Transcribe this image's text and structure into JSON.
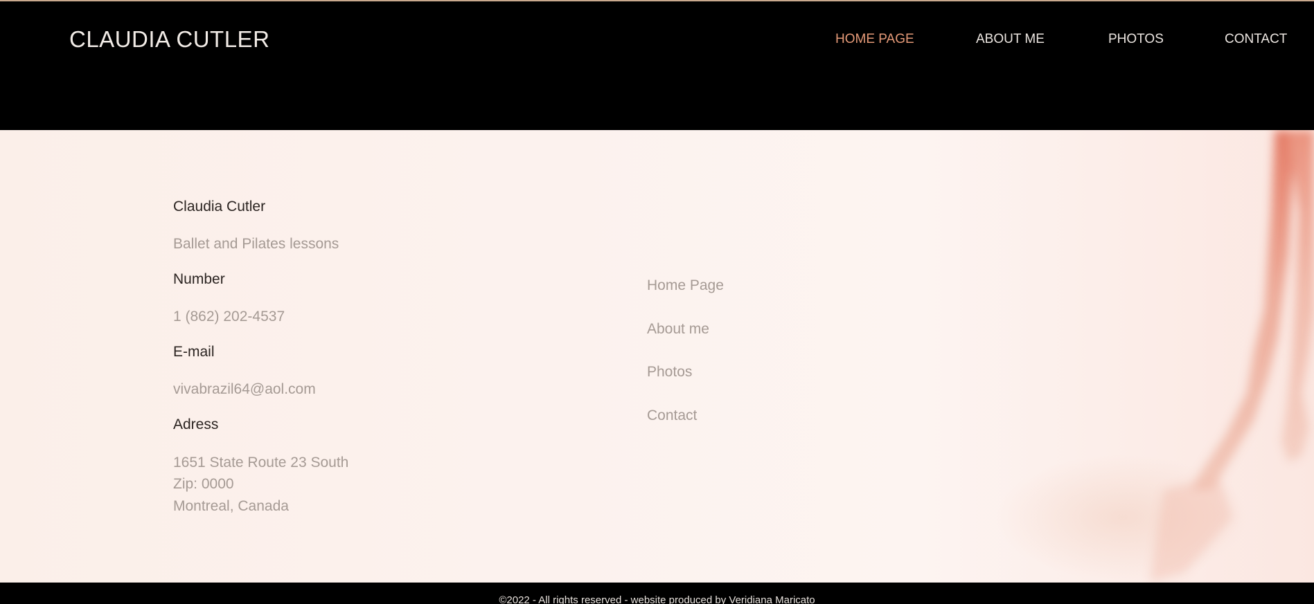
{
  "header": {
    "site_title": "CLAUDIA CUTLER",
    "nav": [
      {
        "label": "HOME PAGE",
        "active": true
      },
      {
        "label": "ABOUT ME",
        "active": false
      },
      {
        "label": "PHOTOS",
        "active": false
      },
      {
        "label": "CONTACT",
        "active": false
      }
    ]
  },
  "contact": {
    "name": "Claudia Cutler",
    "tagline": "Ballet and Pilates lessons",
    "number_label": "Number",
    "number": "1 (862) 202-4537",
    "email_label": "E-mail",
    "email": "vivabrazil64@aol.com",
    "address_label": "Adress",
    "address_lines": [
      "1651 State Route 23 South",
      "Zip: 0000",
      "Montreal, Canada"
    ]
  },
  "footer_nav": [
    "Home Page",
    "About me",
    "Photos",
    "Contact"
  ],
  "footer": {
    "copyright": "©2022 - All rights reserved - website produced by Veridiana Maricato"
  },
  "colors": {
    "header_bg": "#000000",
    "accent": "#e59a78",
    "content_bg": "#fcf2ee",
    "muted_text": "#a59a94"
  }
}
